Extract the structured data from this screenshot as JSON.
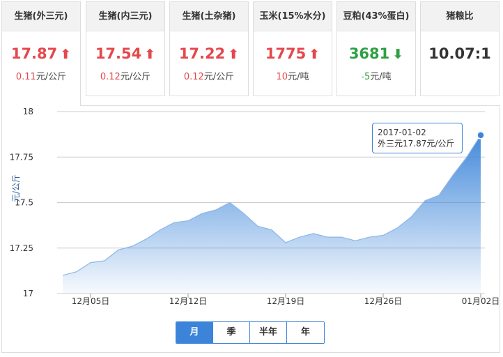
{
  "cards": [
    {
      "title": "生猪(外三元)",
      "value": "17.87",
      "arrow": "🡅",
      "direction": "up",
      "change_num": "0.11",
      "change_unit": "元/公斤"
    },
    {
      "title": "生猪(内三元)",
      "value": "17.54",
      "arrow": "🡅",
      "direction": "up",
      "change_num": "0.12",
      "change_unit": "元/公斤"
    },
    {
      "title": "生猪(土杂猪)",
      "value": "17.22",
      "arrow": "🡅",
      "direction": "up",
      "change_num": "0.12",
      "change_unit": "元/公斤"
    },
    {
      "title": "玉米(15%水分)",
      "value": "1775",
      "arrow": "🡅",
      "direction": "up",
      "change_num": "10",
      "change_unit": "元/吨"
    },
    {
      "title": "豆粕(43%蛋白)",
      "value": "3681",
      "arrow": "🡇",
      "direction": "down",
      "change_num": "-5",
      "change_unit": "元/吨"
    },
    {
      "title": "猪粮比",
      "value": "10.07:1",
      "arrow": "",
      "direction": "neutral",
      "change_num": "",
      "change_unit": ""
    }
  ],
  "tooltip": {
    "date": "2017-01-02",
    "text": "外三元17.87元/公斤"
  },
  "range_tabs": [
    {
      "label": "月",
      "active": true
    },
    {
      "label": "季",
      "active": false
    },
    {
      "label": "半年",
      "active": false
    },
    {
      "label": "年",
      "active": false
    }
  ],
  "colors": {
    "up": "#e5474b",
    "down": "#2ea043",
    "accent": "#3b84d9"
  },
  "chart_data": {
    "type": "area",
    "ylabel": "元/公斤",
    "ylim": [
      17,
      18
    ],
    "yticks": [
      "17",
      "17.25",
      "17.5",
      "17.75",
      "18"
    ],
    "ytick_values": [
      17,
      17.25,
      17.5,
      17.75,
      18
    ],
    "xtick_labels": [
      "12月05日",
      "12月12日",
      "12月19日",
      "12月26日",
      "01月02日"
    ],
    "xtick_index": [
      3,
      10,
      17,
      24,
      31
    ],
    "grid": true,
    "series": [
      {
        "values": [
          17.1,
          17.12,
          17.17,
          17.18,
          17.24,
          17.26,
          17.3,
          17.35,
          17.39,
          17.4,
          17.44,
          17.46,
          17.5,
          17.44,
          17.37,
          17.35,
          17.28,
          17.31,
          17.33,
          17.31,
          17.31,
          17.29,
          17.31,
          17.32,
          17.36,
          17.42,
          17.51,
          17.54,
          17.65,
          17.75,
          17.87
        ]
      }
    ]
  }
}
